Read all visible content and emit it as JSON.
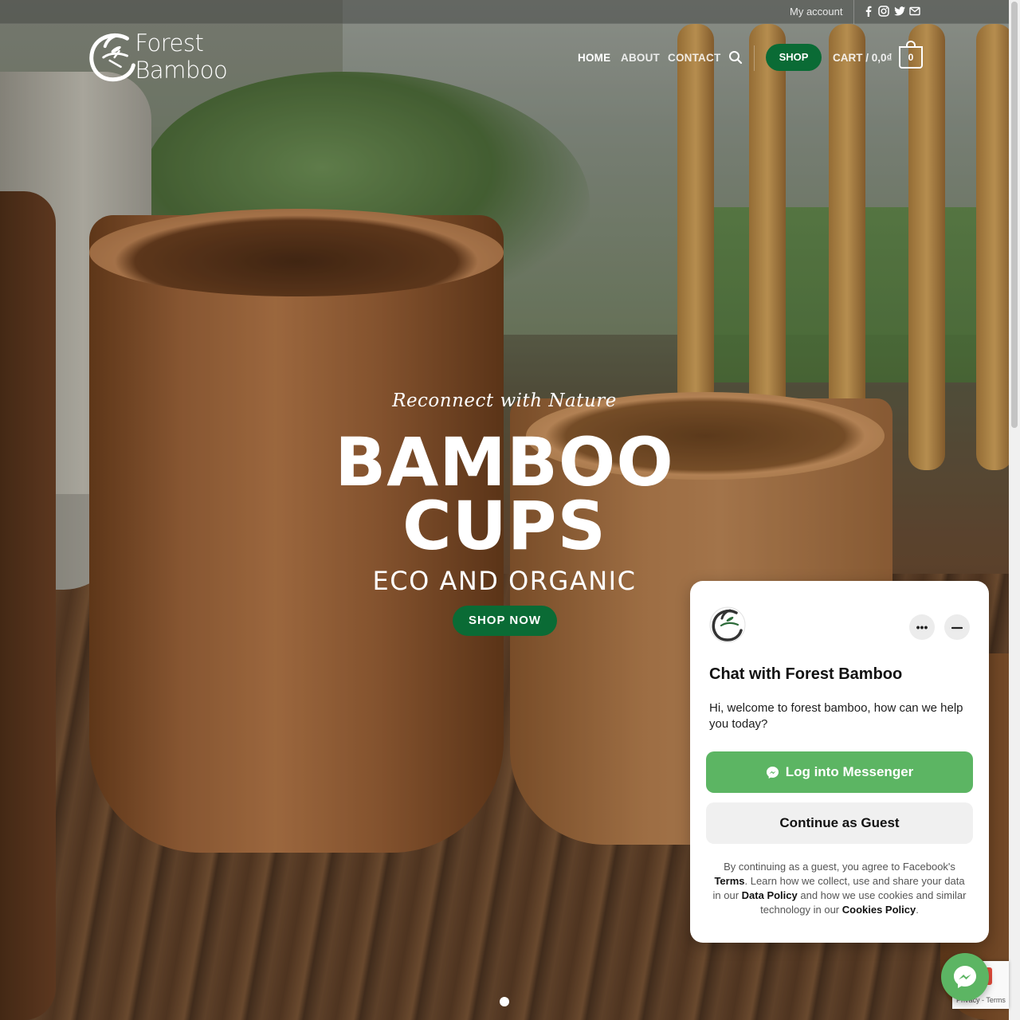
{
  "topbar": {
    "my_account": "My account",
    "social_icons": [
      "facebook-icon",
      "instagram-icon",
      "twitter-icon",
      "email-icon"
    ]
  },
  "header": {
    "logo_text": "Forest Bamboo",
    "nav": [
      "HOME",
      "ABOUT",
      "CONTACT"
    ],
    "shop_label": "SHOP",
    "cart_label": "CART / 0,0₫",
    "cart_count": "0"
  },
  "hero": {
    "tagline": "Reconnect with Nature",
    "title_line1": "BAMBOO",
    "title_line2": "CUPS",
    "subtitle": "ECO AND ORGANIC",
    "cta": "SHOP NOW",
    "slide_active": 1
  },
  "chat": {
    "title": "Chat with Forest Bamboo",
    "message": "Hi, welcome to forest bamboo, how can we help you today?",
    "more_label": "•••",
    "login_label": "Log into Messenger",
    "guest_label": "Continue as Guest",
    "legal_1": "By continuing as a guest, you agree to Facebook's ",
    "legal_terms": "Terms",
    "legal_2": ". Learn how we collect, use and share your data in our ",
    "legal_data_policy": "Data Policy",
    "legal_3": " and how we use cookies and similar technology in our ",
    "legal_cookies": "Cookies Policy",
    "legal_4": "."
  },
  "recaptcha": {
    "text": "Privacy - Terms"
  },
  "colors": {
    "brand_green": "#0a6b35",
    "messenger_green": "#5cb563"
  }
}
